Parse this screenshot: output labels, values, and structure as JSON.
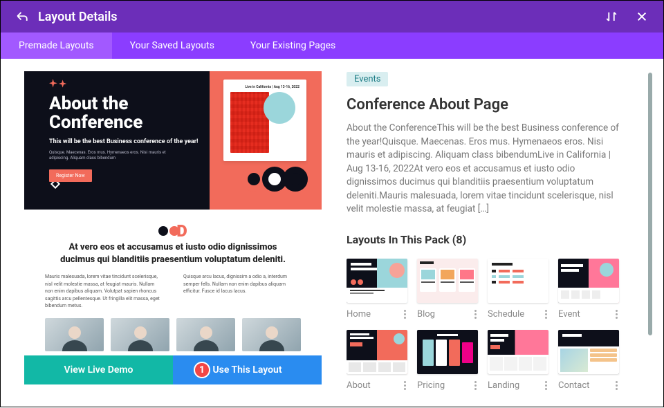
{
  "topbar": {
    "title": "Layout Details"
  },
  "tabs": {
    "premade": "Premade Layouts",
    "saved": "Your Saved Layouts",
    "existing": "Your Existing Pages"
  },
  "preview": {
    "hero_title_l1": "About the",
    "hero_title_l2": "Conference",
    "hero_sub": "This will be the best Business conference of the year!",
    "hero_caption": "Quisque. Maecenas. Eros mus. Hymenaeos eros. Nisi mauris et adipiscing. Aliquam class bibendum",
    "register": "Register Now",
    "card_top": "Live in California | Aug 13-16, 2022",
    "mid_heading": "At vero eos et accusamus et iusto odio dignissimos ducimus qui blanditiis praesentium voluptatum deleniti.",
    "mid_col1": "Mauris malesuada, lorem vitae tincidunt scelerisque, nisl velit molestie massa, at feugiat mauris. Nullam non enim dapibus aliquam. Volutpat sapien rhoncus sagittis arcu pellentesque. Ut fringilla elit massa, eget bibendum metus.",
    "mid_col2": "Quisque arcu lacus, dignissim a odio a, interdum semper fells. Nullam non enim dapibus aliquam efficitur. Fusce id lacus lacus."
  },
  "actions": {
    "demo": "View Live Demo",
    "use": "Use This Layout",
    "badge": "1"
  },
  "detail": {
    "tag": "Events",
    "title": "Conference About Page",
    "description": "About the ConferenceThis will be the best Business conference of the year!Quisque. Maecenas. Eros mus. Hymenaeos eros. Nisi mauris et adipiscing. Aliquam class bibendumLive in California | Aug 13-16, 2022At vero eos et accusamus et iusto odio dignissimos ducimus qui blanditiis praesentium voluptatum deleniti.Mauris malesuada, lorem vitae tincidunt scelerisque, nisl velit molestie massa, at feugiat […]",
    "pack_heading": "Layouts In This Pack (8)"
  },
  "thumbs": {
    "home": "Home",
    "blog": "Blog",
    "schedule": "Schedule",
    "event": "Event",
    "about": "About",
    "pricing": "Pricing",
    "landing": "Landing",
    "contact": "Contact"
  }
}
